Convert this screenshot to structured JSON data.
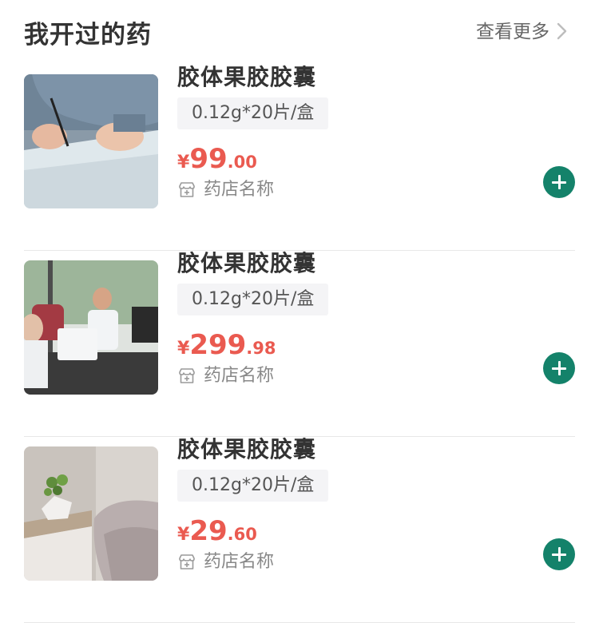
{
  "header": {
    "title": "我开过的药",
    "more_label": "查看更多"
  },
  "products": [
    {
      "name": "胶体果胶胶囊",
      "spec": "0.12g*20片/盒",
      "currency": "¥",
      "price_int": "99",
      "price_dec": ".00",
      "store": "药店名称",
      "image": "person-writing-photo"
    },
    {
      "name": "胶体果胶胶囊",
      "spec": "0.12g*20片/盒",
      "currency": "¥",
      "price_int": "299",
      "price_dec": ".98",
      "store": "药店名称",
      "image": "office-team-photo"
    },
    {
      "name": "胶体果胶胶囊",
      "spec": "0.12g*20片/盒",
      "currency": "¥",
      "price_int": "29",
      "price_dec": ".60",
      "store": "药店名称",
      "image": "plant-chair-photo"
    }
  ],
  "colors": {
    "price": "#ea5a50",
    "add_button": "#14826a"
  }
}
